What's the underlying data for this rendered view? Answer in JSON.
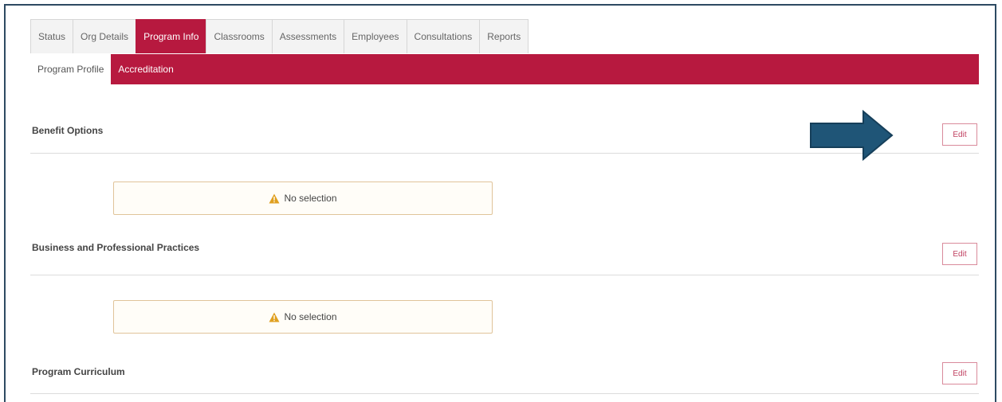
{
  "tabs": [
    {
      "label": "Status",
      "active": false
    },
    {
      "label": "Org Details",
      "active": false
    },
    {
      "label": "Program Info",
      "active": true
    },
    {
      "label": "Classrooms",
      "active": false
    },
    {
      "label": "Assessments",
      "active": false
    },
    {
      "label": "Employees",
      "active": false
    },
    {
      "label": "Consultations",
      "active": false
    },
    {
      "label": "Reports",
      "active": false
    }
  ],
  "subtabs": [
    {
      "label": "Program Profile",
      "active": true
    },
    {
      "label": "Accreditation",
      "active": false
    }
  ],
  "sections": [
    {
      "title": "Benefit Options",
      "edit_label": "Edit",
      "status": "No selection"
    },
    {
      "title": "Business and Professional Practices",
      "edit_label": "Edit",
      "status": "No selection"
    },
    {
      "title": "Program Curriculum",
      "edit_label": "Edit"
    }
  ],
  "colors": {
    "accent": "#b7193f",
    "frame": "#2d4a62",
    "callout_arrow": "#1f5577",
    "warning": "#e0a020"
  },
  "icons": {
    "warning": "warning-icon",
    "callout": "callout-arrow-icon"
  }
}
